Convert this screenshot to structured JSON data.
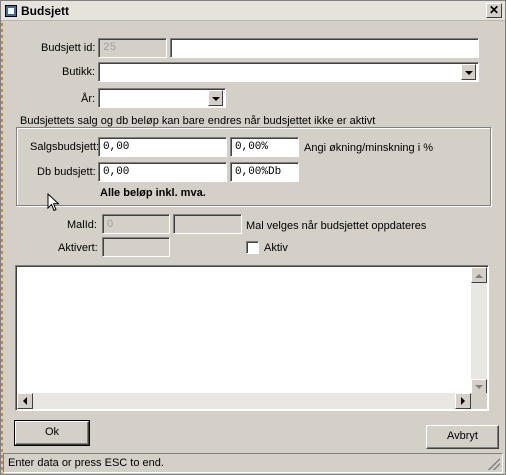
{
  "window": {
    "title": "Budsjett",
    "close_glyph": "✕"
  },
  "form": {
    "budsjett_id": {
      "label": "Budsjett id:",
      "value": "25",
      "name_value": ""
    },
    "butikk": {
      "label": "Butikk:",
      "value": ""
    },
    "aar": {
      "label": "År:",
      "value": ""
    },
    "note": "Budsjettets salg og db beløp kan bare endres når budsjettet ikke er aktivt",
    "salgsbudsjett": {
      "label": "Salgsbudsjett:",
      "value": "0,00",
      "percent": "0,00%"
    },
    "db_budsjett": {
      "label": "Db budsjett:",
      "value": "0,00",
      "percent": "0,00%Db"
    },
    "percent_hint": "Angi økning/minskning i %",
    "vat_note": "Alle beløp inkl. mva.",
    "malid": {
      "label": "MalId:",
      "value": "0",
      "name_value": ""
    },
    "mal_hint": "Mal velges når budsjettet oppdateres",
    "aktivert": {
      "label": "Aktivert:",
      "value": ""
    },
    "aktiv": {
      "label": "Aktiv",
      "checked": false
    }
  },
  "buttons": {
    "ok": "Ok",
    "avbryt": "Avbryt"
  },
  "status": "Enter data or press ESC to end.",
  "icons": [
    "app-icon",
    "close-icon",
    "dropdown-arrow-icon",
    "scroll-up-icon",
    "scroll-down-icon",
    "scroll-left-icon",
    "scroll-right-icon",
    "mouse-cursor-icon",
    "size-grip-icon"
  ]
}
